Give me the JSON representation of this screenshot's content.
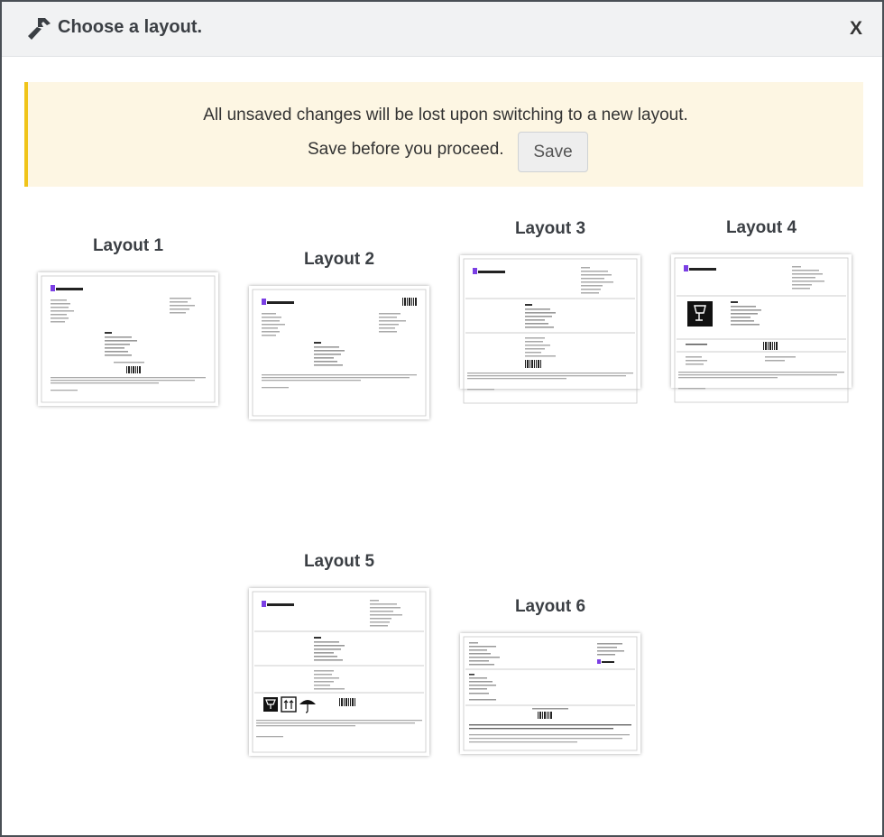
{
  "dialog": {
    "title": "Choose a layout.",
    "close_label": "X"
  },
  "alert": {
    "line1": "All unsaved changes will be lost upon switching to a new layout.",
    "line2": "Save before you proceed.",
    "save_label": "Save"
  },
  "colors": {
    "accent": "#f0c419",
    "alert_bg": "#fdf6e3",
    "header_bg": "#f1f2f3",
    "logo_purple": "#7b3fe4"
  },
  "layouts": [
    {
      "label": "Layout 1"
    },
    {
      "label": "Layout 2"
    },
    {
      "label": "Layout 3"
    },
    {
      "label": "Layout 4"
    },
    {
      "label": "Layout 5"
    },
    {
      "label": "Layout 6"
    }
  ]
}
